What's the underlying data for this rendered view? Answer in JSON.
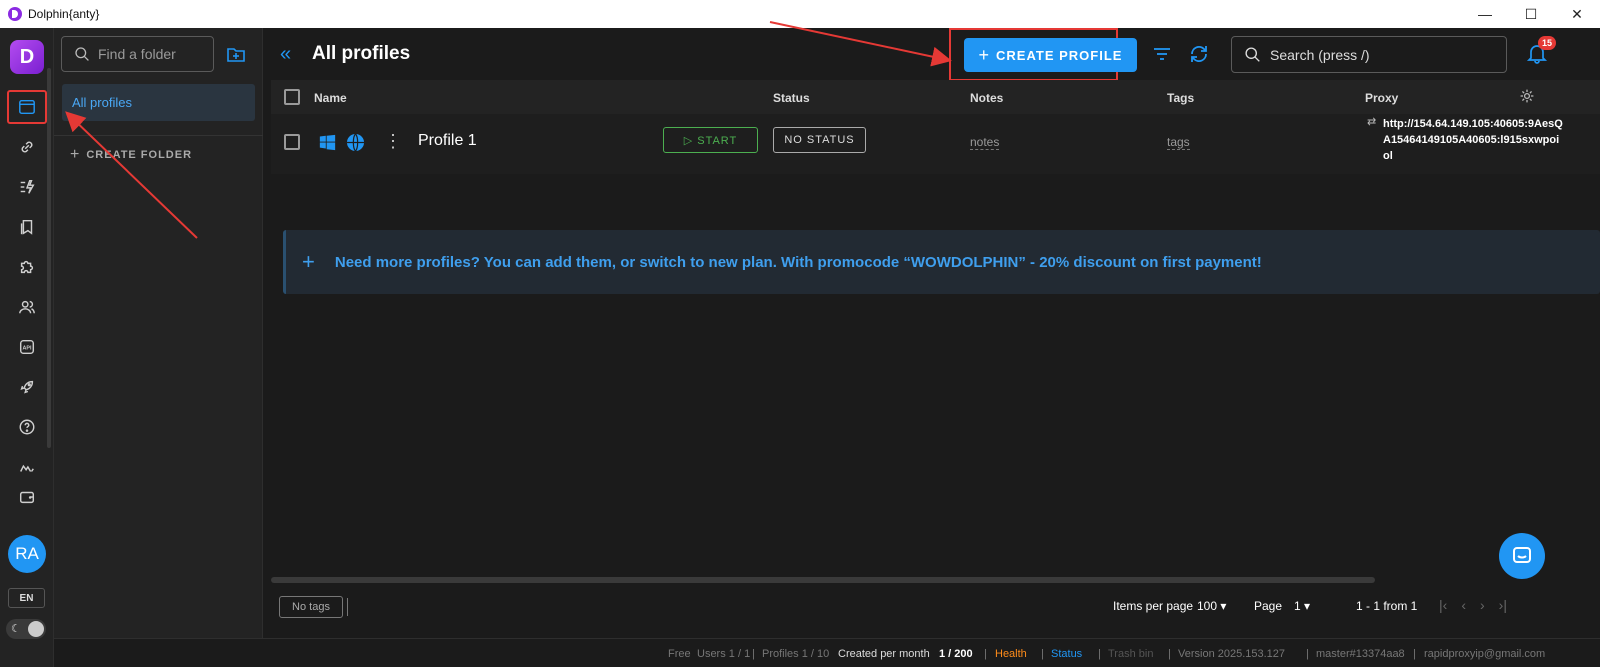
{
  "window": {
    "title": "Dolphin{anty}",
    "controls": [
      "—",
      "☐",
      "✕"
    ]
  },
  "rail": {
    "logo": "D",
    "avatar": "RA",
    "lang": "EN",
    "theme_icon": "☾"
  },
  "folders": {
    "find_placeholder": "Find a folder",
    "all_profiles": "All profiles",
    "create_folder": "CREATE FOLDER",
    "plus": "+"
  },
  "header": {
    "collapse": "«",
    "title": "All profiles",
    "create_profile": "CREATE PROFILE",
    "plus": "+",
    "search_placeholder": "Search (press /)",
    "notification_count": "15"
  },
  "table": {
    "columns": {
      "name": "Name",
      "status": "Status",
      "notes": "Notes",
      "tags": "Tags",
      "proxy": "Proxy"
    },
    "rows": [
      {
        "name": "Profile 1",
        "start": "▷ START",
        "status": "NO STATUS",
        "notes": "notes",
        "tags": "tags",
        "proxy": "http://154.64.149.105:40605:9AesQA15464149105A40605:l915sxwpoiol",
        "proxy_icon": "⇄",
        "more_icon": "⋮"
      }
    ]
  },
  "promo": {
    "plus": "+",
    "text": "Need more profiles? You can add them, or switch to new plan. With promocode “WOWDOLPHIN” - 20% discount on first payment!"
  },
  "footer": {
    "no_tags": "No tags",
    "items_per_page_label": "Items per page",
    "items_per_page_value": "100 ▾",
    "page_label": "Page",
    "page_value": "1 ▾",
    "range": "1 - 1 from 1",
    "nav": [
      "|‹",
      "‹",
      "›",
      "›|"
    ]
  },
  "statusbar": {
    "plan": "Free",
    "users": "Users 1 / 1",
    "profiles": "Profiles 1 / 10",
    "created_label": "Created per month",
    "created_value": "1 / 200",
    "health": "Health",
    "status": "Status",
    "trash": "Trash bin",
    "version": "Version 2025.153.127",
    "build": "master#13374aa8",
    "email": "rapidproxyip@gmail.com",
    "sep": "|",
    "health_color": "#ff8c1a",
    "status_color": "#2196f3"
  }
}
